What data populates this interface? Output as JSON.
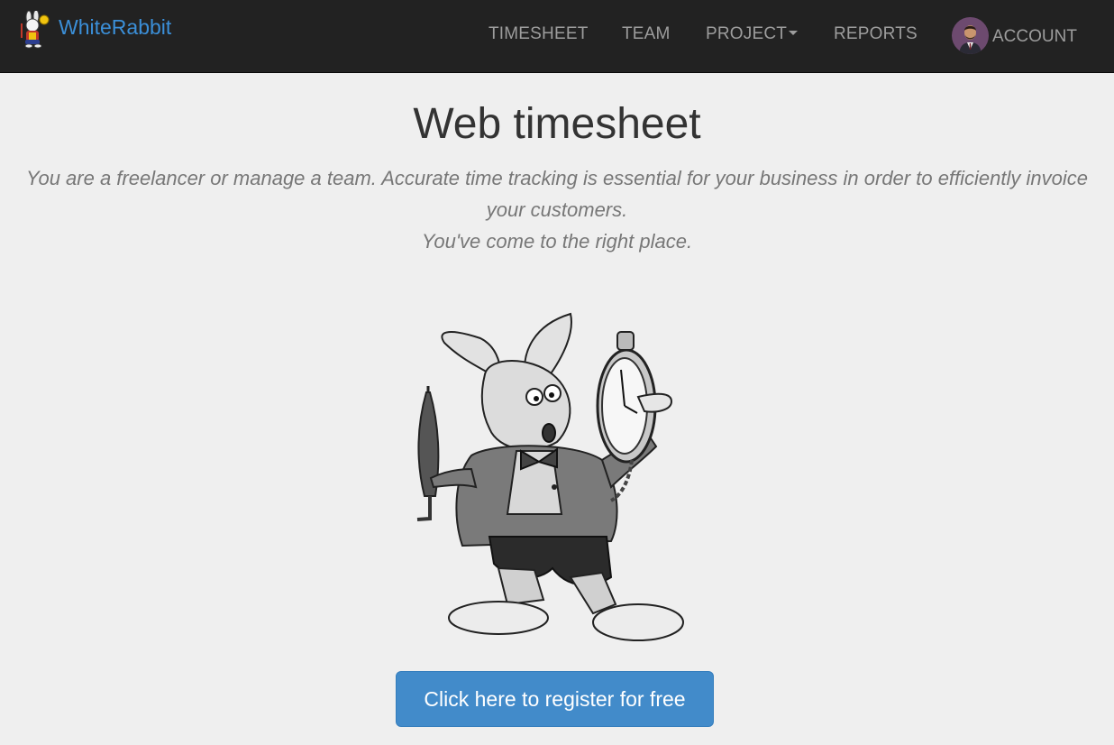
{
  "navbar": {
    "brand": "WhiteRabbit",
    "items": [
      {
        "label": "TIMESHEET"
      },
      {
        "label": "TEAM"
      },
      {
        "label": "PROJECT"
      },
      {
        "label": "REPORTS"
      }
    ],
    "account_label": "ACCOUNT"
  },
  "hero": {
    "title": "Web timesheet",
    "tagline_line1": "You are a freelancer or manage a team. Accurate time tracking is essential for your business in order to efficiently invoice",
    "tagline_line2": "your customers.",
    "tagline_line3": "You've come to the right place."
  },
  "cta": {
    "label": "Click here to register for free"
  },
  "icons": {
    "brand": "white-rabbit-logo-icon",
    "dropdown": "caret-down-icon",
    "account": "user-avatar",
    "hero": "white-rabbit-illustration"
  },
  "colors": {
    "navbar_bg": "#222222",
    "brand": "#3b8fd8",
    "nav_text": "#9d9d9d",
    "page_bg": "#efefef",
    "tagline": "#777777",
    "cta_bg": "#428bca"
  }
}
